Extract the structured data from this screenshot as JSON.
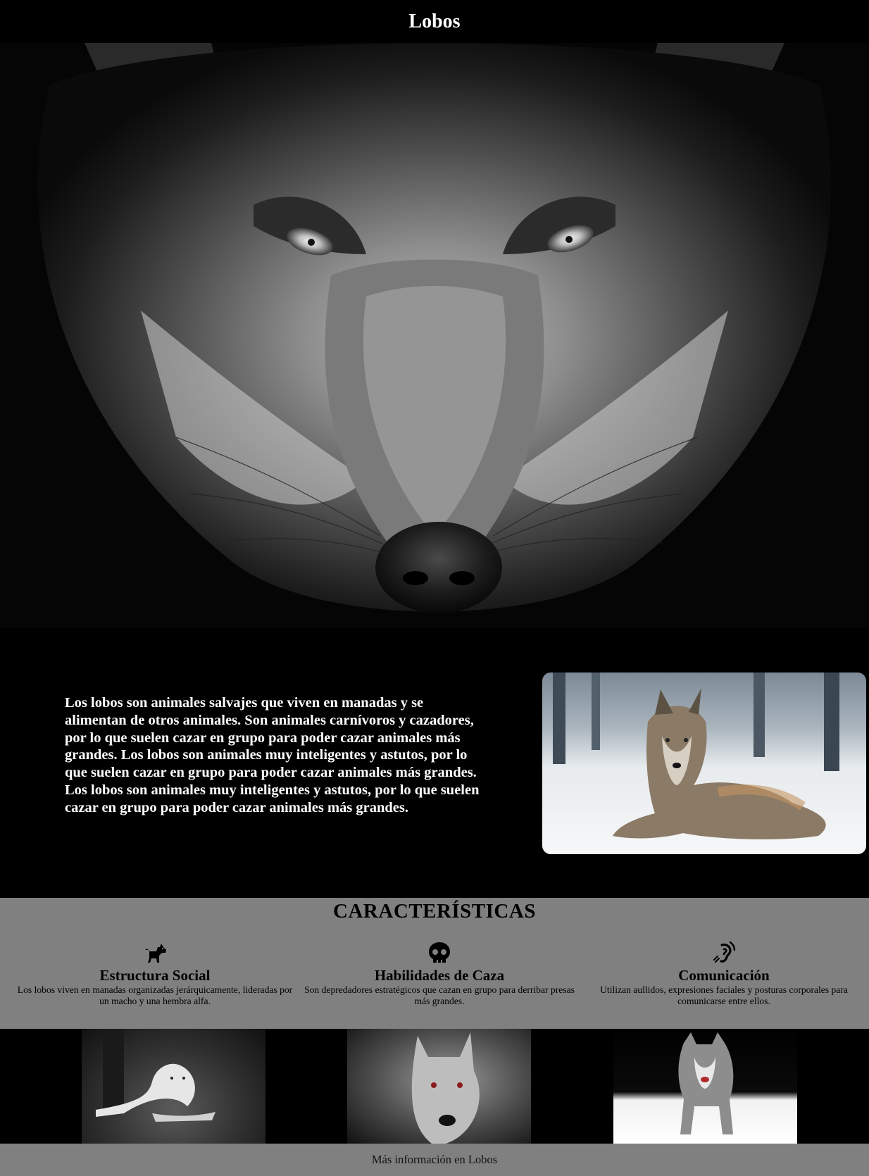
{
  "header": {
    "title": "Lobos"
  },
  "intro": {
    "text": "Los lobos son animales salvajes que viven en manadas y se alimentan de otros animales. Son animales carnívoros y cazadores, por lo que suelen cazar en grupo para poder cazar animales más grandes. Los lobos son animales muy inteligentes y astutos, por lo que suelen cazar en grupo para poder cazar animales más grandes. Los lobos son animales muy inteligentes y astutos, por lo que suelen cazar en grupo para poder cazar animales más grandes."
  },
  "features": {
    "title": "CARACTERÍSTICAS",
    "items": [
      {
        "icon": "dog-icon",
        "title": "Estructura Social",
        "text": "Los lobos viven en manadas organizadas jerárquicamente, lideradas por un macho y una hembra alfa."
      },
      {
        "icon": "skull-icon",
        "title": "Habilidades de Caza",
        "text": "Son depredadores estratégicos que cazan en grupo para derribar presas más grandes."
      },
      {
        "icon": "ear-listen-icon",
        "title": "Comunicación",
        "text": "Utilizan aullidos, expresiones faciales y posturas corporales para comunicarse entre ellos."
      }
    ]
  },
  "footer": {
    "link": "Más información en Lobos"
  },
  "colors": {
    "background": "#000000",
    "features_bg": "#808080",
    "text_light": "#ffffff",
    "text_dark": "#000000"
  }
}
